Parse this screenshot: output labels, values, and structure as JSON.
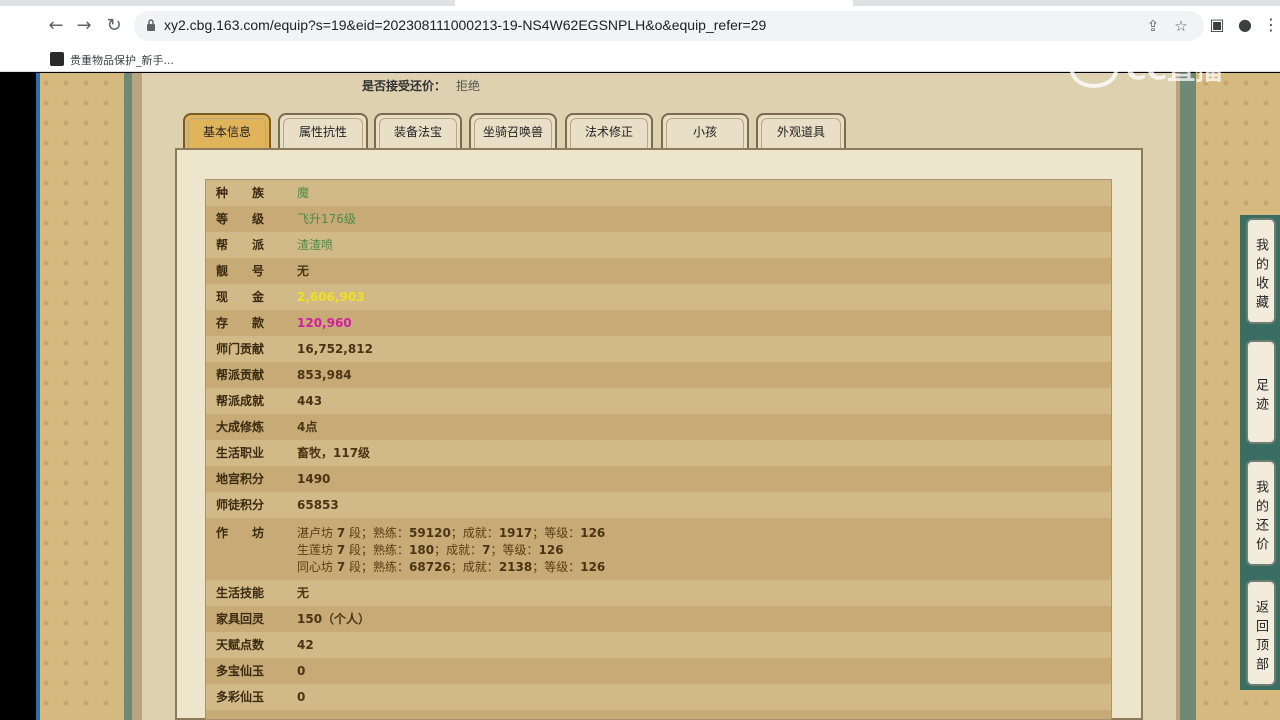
{
  "browser": {
    "url": "xy2.cbg.163.com/equip?s=19&eid=202308111000213-19-NS4W62EGSNPLH&o&equip_refer=29",
    "bookmark_label": "贵重物品保护_新手...",
    "icons": [
      "back-icon",
      "forward-icon",
      "reload-icon",
      "lock-icon",
      "share-icon",
      "star-icon",
      "sidebar-icon",
      "profile-icon",
      "menu-icon"
    ]
  },
  "watermark": "CC直播",
  "header": {
    "counter_offer_label": "是否接受还价：",
    "counter_offer_value": "拒绝"
  },
  "tabs": [
    {
      "label": "基本信息",
      "active": true
    },
    {
      "label": "属性抗性",
      "active": false
    },
    {
      "label": "装备法宝",
      "active": false
    },
    {
      "label": "坐骑召唤兽",
      "active": false
    },
    {
      "label": "法术修正",
      "active": false
    },
    {
      "label": "小孩",
      "active": false
    },
    {
      "label": "外观道具",
      "active": false
    }
  ],
  "rows": [
    {
      "key": "种　　族",
      "value": "魔",
      "style": "green"
    },
    {
      "key": "等　　级",
      "value": "飞升176级",
      "style": "green"
    },
    {
      "key": "帮　　派",
      "value": "渣渣喷",
      "style": "green"
    },
    {
      "key": "靓　　号",
      "value": "无",
      "style": "dark"
    },
    {
      "key": "现　　金",
      "value": "2,606,903",
      "style": "yellow"
    },
    {
      "key": "存　　款",
      "value": "120,960",
      "style": "magenta"
    },
    {
      "key": "师门贡献",
      "value": "16,752,812",
      "style": "dark"
    },
    {
      "key": "帮派贡献",
      "value": "853,984",
      "style": "dark"
    },
    {
      "key": "帮派成就",
      "value": "443",
      "style": "dark"
    },
    {
      "key": "大成修炼",
      "value": "4点",
      "style": "dark"
    },
    {
      "key": "生活职业",
      "value": "畜牧，117级",
      "style": "dark"
    },
    {
      "key": "地宫积分",
      "value": "1490",
      "style": "dark"
    },
    {
      "key": "师徒积分",
      "value": "65853",
      "style": "dark"
    },
    {
      "key": "作　　坊",
      "value": "",
      "style": "dark"
    },
    {
      "key": "生活技能",
      "value": "无",
      "style": "dark"
    },
    {
      "key": "家具回灵",
      "value": "150（个人）",
      "style": "dark"
    },
    {
      "key": "天赋点数",
      "value": "42",
      "style": "dark"
    },
    {
      "key": "多宝仙玉",
      "value": "0",
      "style": "dark"
    },
    {
      "key": "多彩仙玉",
      "value": "0",
      "style": "dark"
    }
  ],
  "workshops": [
    {
      "name": "湛卢坊",
      "stage": "7",
      "seg": "段；熟练：",
      "skill": "59120",
      "ach_label": "；成就：",
      "ach": "1917",
      "lvl_label": "；等级：",
      "lvl": "126"
    },
    {
      "name": "生莲坊",
      "stage": "7",
      "seg": "段；熟练：",
      "skill": "180",
      "ach_label": "；成就：",
      "ach": "7",
      "lvl_label": "；等级：",
      "lvl": "126"
    },
    {
      "name": "同心坊",
      "stage": "7",
      "seg": "段；熟练：",
      "skill": "68726",
      "ach_label": "；成就：",
      "ach": "2138",
      "lvl_label": "；等级：",
      "lvl": "126"
    }
  ],
  "side_buttons": [
    "我的收藏",
    "足迹",
    "我的还价",
    "返回顶部"
  ]
}
